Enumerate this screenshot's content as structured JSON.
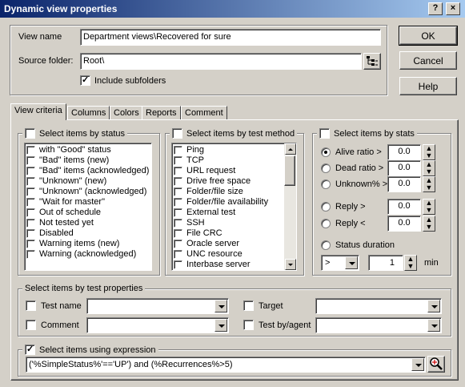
{
  "window": {
    "title": "Dynamic view properties",
    "help_glyph": "?",
    "close_glyph": "×"
  },
  "general": {
    "view_name_label": "View name",
    "view_name_value": "Department views\\Recovered for sure",
    "source_folder_label": "Source folder:",
    "source_folder_value": "Root\\",
    "include_subfolders_label": "Include subfolders",
    "include_subfolders_checked": true
  },
  "buttons": {
    "ok": "OK",
    "cancel": "Cancel",
    "help": "Help"
  },
  "tabs": [
    "View criteria",
    "Columns",
    "Colors",
    "Reports",
    "Comment"
  ],
  "status_group": {
    "title": "Select items by status",
    "items": [
      "with \"Good\" status",
      "\"Bad\" items (new)",
      "\"Bad\" items (acknowledged)",
      "\"Unknown\" (new)",
      "\"Unknown\" (acknowledged)",
      "\"Wait for master\"",
      "Out of schedule",
      "Not tested yet",
      "Disabled",
      "Warning items (new)",
      "Warning (acknowledged)"
    ]
  },
  "method_group": {
    "title": "Select items by test method",
    "items": [
      "Ping",
      "TCP",
      "URL request",
      "Drive free space",
      "Folder/file size",
      "Folder/file availability",
      "External test",
      "SSH",
      "File CRC",
      "Oracle server",
      "UNC resource",
      "Interbase server"
    ]
  },
  "stats_group": {
    "title": "Select items by stats",
    "rows": [
      {
        "label": "Alive ratio >",
        "value": "0.0",
        "selected": true
      },
      {
        "label": "Dead ratio >",
        "value": "0.0",
        "selected": false
      },
      {
        "label": "Unknown% >",
        "value": "0.0",
        "selected": false
      },
      {
        "label": "Reply >",
        "value": "0.0",
        "selected": false
      },
      {
        "label": "Reply <",
        "value": "0.0",
        "selected": false
      }
    ],
    "duration_label": "Status duration",
    "duration_op": ">",
    "duration_value": "1",
    "duration_unit": "min"
  },
  "test_props_group": {
    "title": "Select items by test properties",
    "test_name_label": "Test name",
    "comment_label": "Comment",
    "target_label": "Target",
    "test_by_agent_label": "Test by/agent"
  },
  "expression_group": {
    "title": "Select items using expression",
    "checked": true,
    "value": "('%SimpleStatus%'=='UP') and (%Recurrences%>5)"
  },
  "colors": {
    "title_start": "#0a246a",
    "title_end": "#a6caf0",
    "face": "#d4d0c8"
  }
}
